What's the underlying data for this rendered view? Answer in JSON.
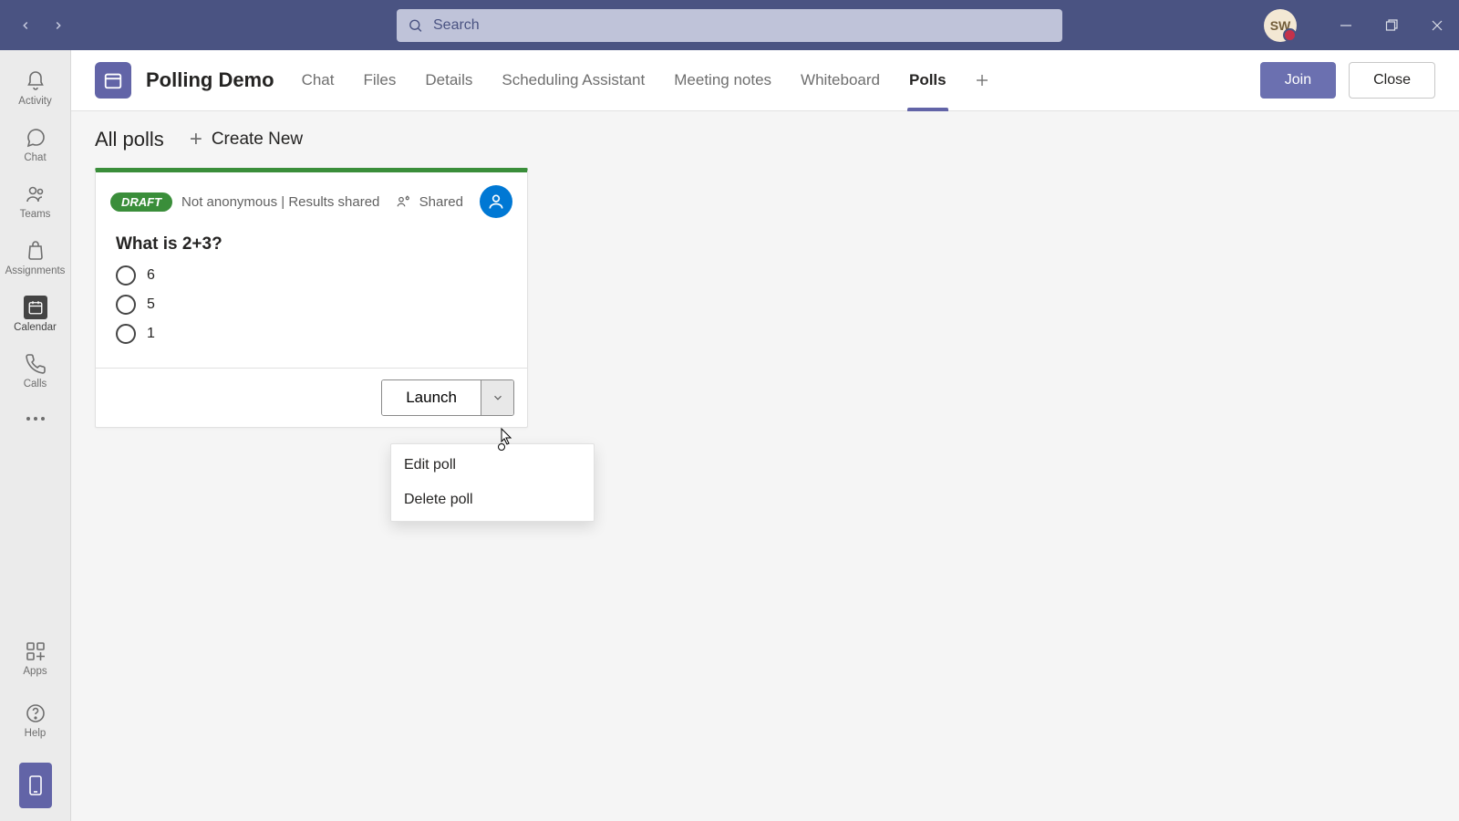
{
  "search": {
    "placeholder": "Search"
  },
  "avatar_initials": "SW",
  "rail": {
    "items": [
      {
        "label": "Activity"
      },
      {
        "label": "Chat"
      },
      {
        "label": "Teams"
      },
      {
        "label": "Assignments"
      },
      {
        "label": "Calendar"
      },
      {
        "label": "Calls"
      }
    ],
    "apps_label": "Apps",
    "help_label": "Help"
  },
  "meeting": {
    "title": "Polling Demo",
    "tabs": [
      "Chat",
      "Files",
      "Details",
      "Scheduling Assistant",
      "Meeting notes",
      "Whiteboard",
      "Polls"
    ],
    "active_tab": "Polls",
    "join_label": "Join",
    "close_label": "Close"
  },
  "polls": {
    "section_title": "All polls",
    "create_label": "Create New",
    "card": {
      "badge": "DRAFT",
      "meta": "Not anonymous | Results shared",
      "shared_label": "Shared",
      "question": "What is 2+3?",
      "options": [
        "6",
        "5",
        "1"
      ],
      "launch_label": "Launch"
    },
    "menu": {
      "edit": "Edit poll",
      "delete": "Delete poll"
    }
  }
}
